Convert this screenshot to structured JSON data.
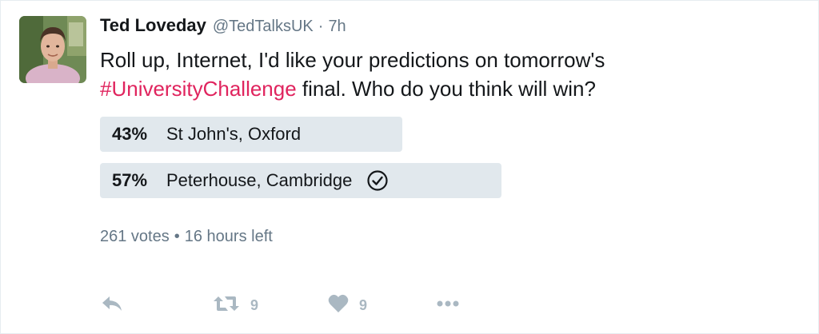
{
  "tweet": {
    "author_name": "Ted Loveday",
    "handle": "@TedTalksUK",
    "separator": "·",
    "time": "7h",
    "text_before": "Roll up, Internet, I'd like your predictions on tomorrow's ",
    "hashtag": "#UniversityChallenge",
    "text_after": " final. Who do you think will win?"
  },
  "poll": {
    "options": [
      {
        "percent_label": "43%",
        "percent": 43,
        "label": "St John's, Oxford",
        "winner": false
      },
      {
        "percent_label": "57%",
        "percent": 57,
        "label": "Peterhouse, Cambridge",
        "winner": true
      }
    ],
    "votes": "261 votes",
    "meta_separator": "•",
    "time_left": "16 hours left"
  },
  "actions": {
    "reply_icon": "reply-icon",
    "retweet_icon": "retweet-icon",
    "retweet_count": "9",
    "like_icon": "heart-icon",
    "like_count": "9",
    "more_icon": "more-icon"
  },
  "colors": {
    "hashtag": "#e0245e",
    "poll_bar": "#e1e8ed",
    "muted": "#657786",
    "action_icon": "#aab8c2"
  }
}
